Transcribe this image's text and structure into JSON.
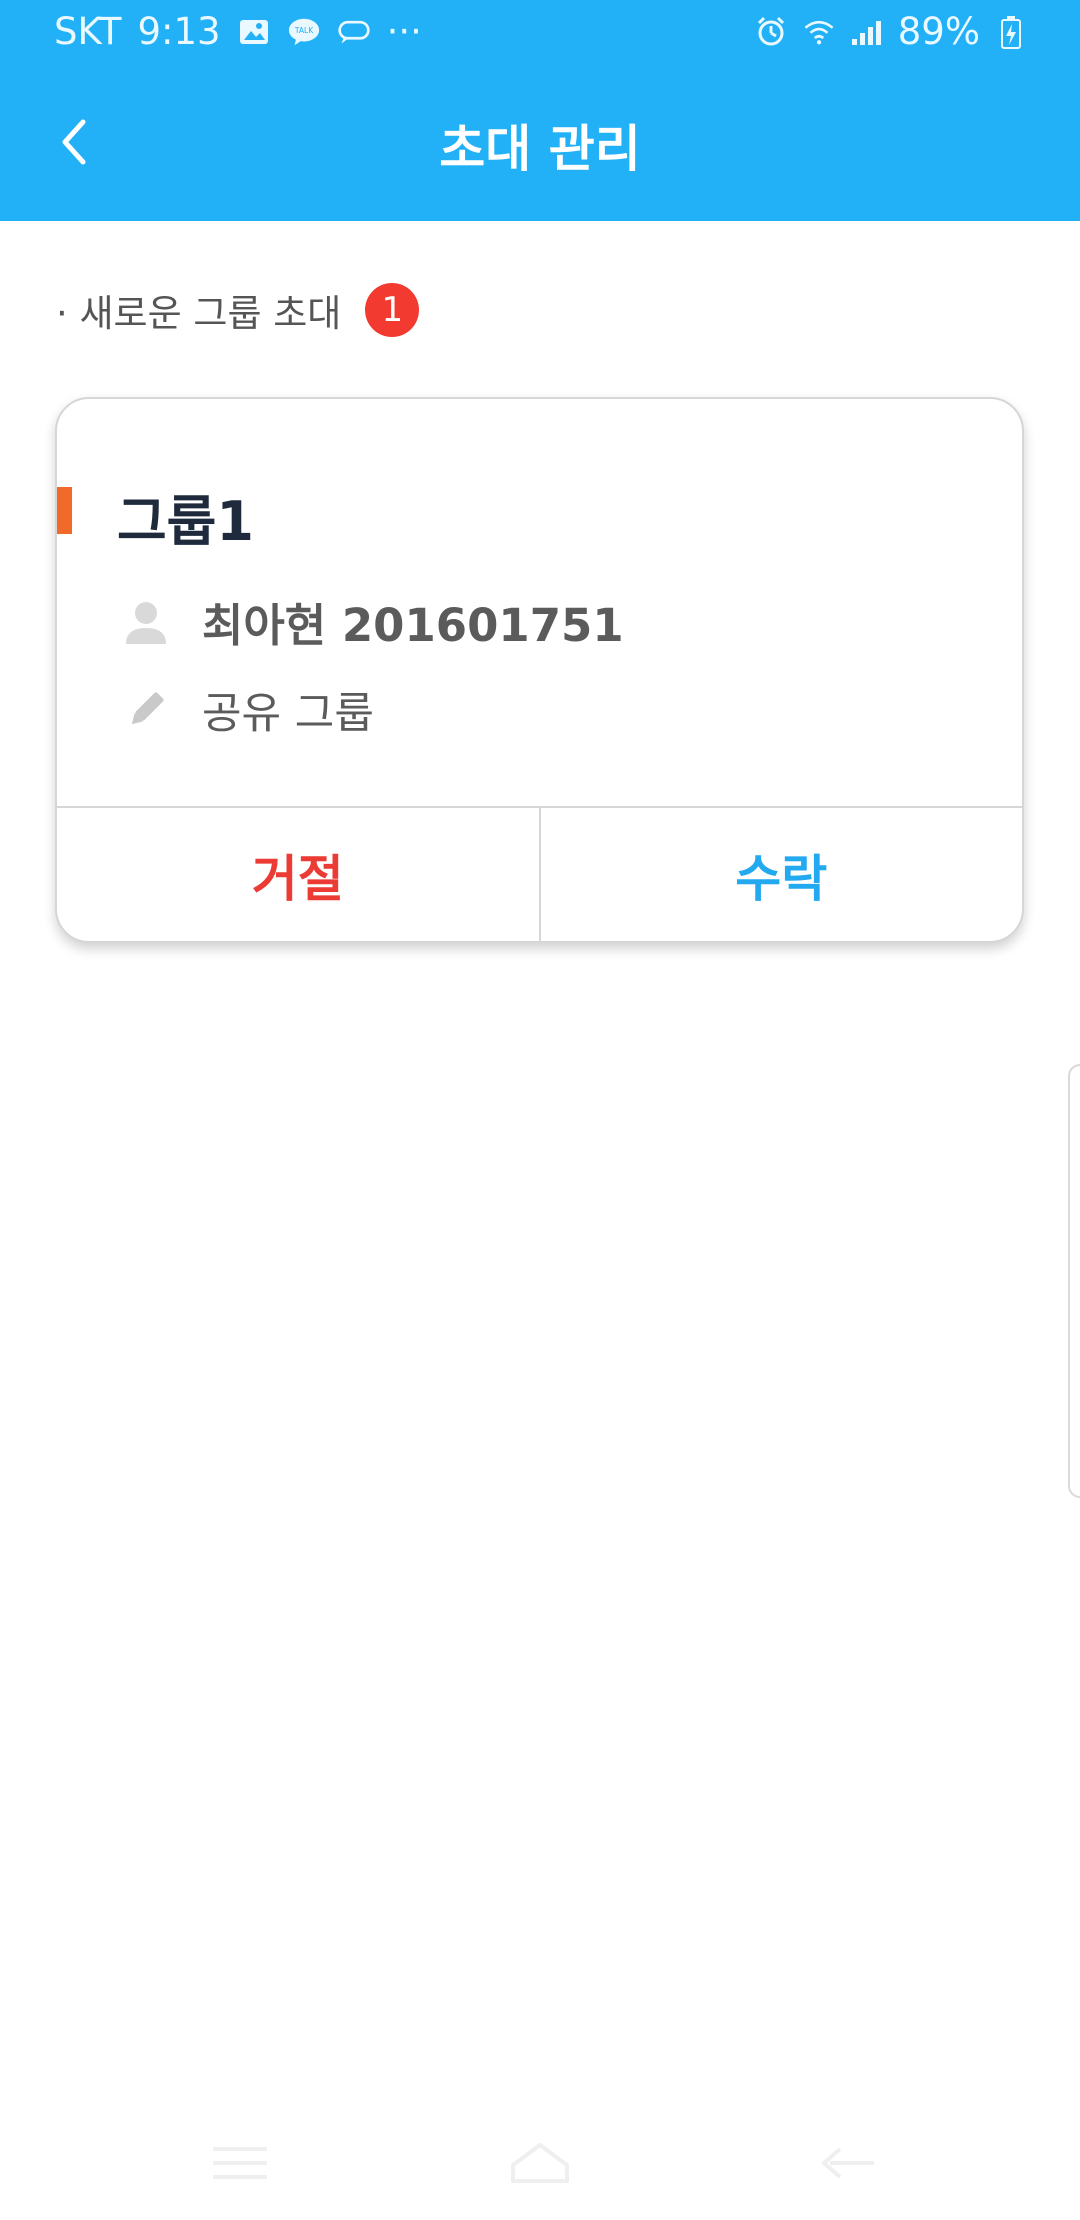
{
  "status_bar": {
    "carrier": "SKT",
    "time": "9:13",
    "more": "···",
    "battery_percent": "89%",
    "left_icons": [
      "image-icon",
      "talk-icon",
      "message-bubble-icon"
    ],
    "right_icons": [
      "alarm-icon",
      "wifi-icon",
      "signal-icon",
      "battery-charging-icon"
    ]
  },
  "header": {
    "title": "초대 관리",
    "background_color": "#22b1f6"
  },
  "section": {
    "heading": "· 새로운 그룹 초대",
    "count": "1",
    "badge_color": "#f23a30"
  },
  "invitation": {
    "group_name": "그룹1",
    "inviter": "최아현 201601751",
    "group_type": "공유 그룹",
    "accent_color": "#f26a2a",
    "reject_label": "거절",
    "reject_color": "#ec3a34",
    "accept_label": "수락",
    "accept_color": "#22a9ef"
  },
  "navigation": {
    "icons": [
      "recent-apps-icon",
      "home-icon",
      "back-nav-icon"
    ]
  }
}
